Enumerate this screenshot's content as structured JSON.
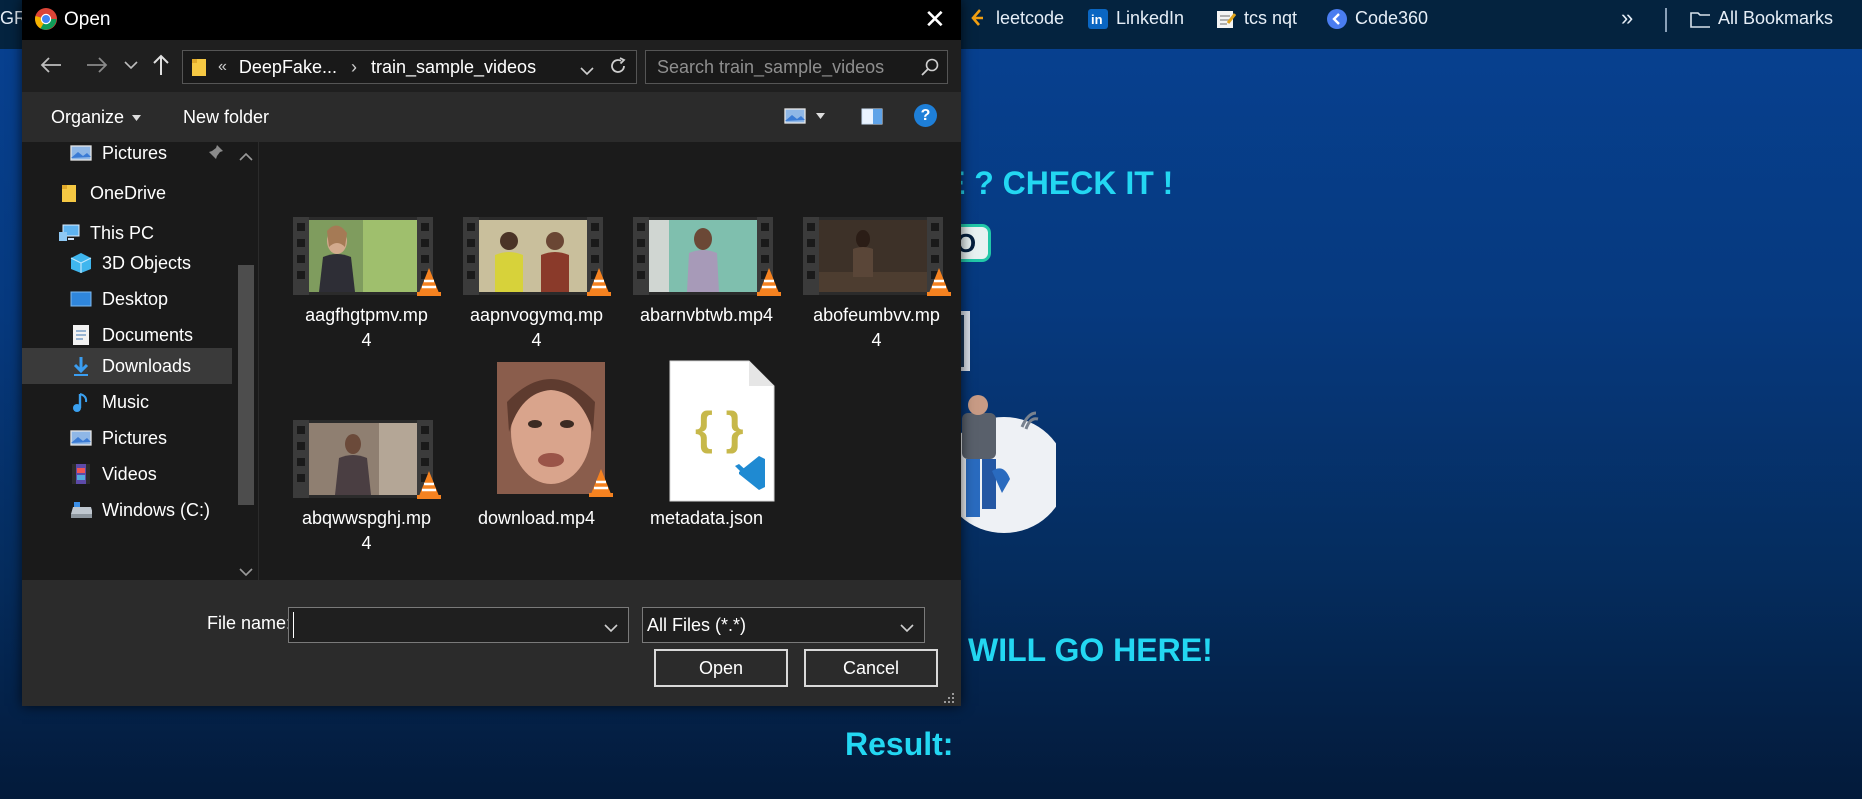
{
  "bookmarks": {
    "left_fragment": "GRE",
    "items": [
      {
        "label": "leetcode",
        "icon": "leetcode-icon"
      },
      {
        "label": "LinkedIn",
        "icon": "linkedin-icon"
      },
      {
        "label": "tcs nqt",
        "icon": "note-icon"
      },
      {
        "label": "Code360",
        "icon": "code360-icon"
      }
    ],
    "overflow": "»",
    "all_bookmarks": "All Bookmarks"
  },
  "webpage": {
    "heading_fragment": "E ? CHECK IT !",
    "button_fragment": "O",
    "placeholder_fragment": "WILL GO HERE!",
    "result_label": "Result:"
  },
  "dialog": {
    "title": "Open",
    "close": "✕",
    "address": {
      "chevrons": "«",
      "crumbs": [
        "DeepFake...",
        "train_sample_videos"
      ],
      "separator": "›",
      "search_placeholder": "Search train_sample_videos"
    },
    "toolbar": {
      "organize": "Organize",
      "new_folder": "New folder",
      "help": "?"
    },
    "nav": [
      {
        "label": "Pictures",
        "icon": "pictures-icon",
        "pinned": true
      },
      {
        "label": "OneDrive",
        "icon": "onedrive-folder-icon"
      },
      {
        "label": "This PC",
        "icon": "this-pc-icon"
      },
      {
        "label": "3D Objects",
        "icon": "3d-objects-icon"
      },
      {
        "label": "Desktop",
        "icon": "desktop-icon"
      },
      {
        "label": "Documents",
        "icon": "documents-icon"
      },
      {
        "label": "Downloads",
        "icon": "downloads-icon",
        "selected": true
      },
      {
        "label": "Music",
        "icon": "music-icon"
      },
      {
        "label": "Pictures",
        "icon": "pictures-icon"
      },
      {
        "label": "Videos",
        "icon": "videos-icon"
      },
      {
        "label": "Windows (C:)",
        "icon": "drive-icon"
      }
    ],
    "files": [
      {
        "name": "aagfhgtpmv.mp4",
        "line1": "aagfhgtpmv.mp",
        "line2": "4",
        "type": "video"
      },
      {
        "name": "aapnvogymq.mp4",
        "line1": "aapnvogymq.mp",
        "line2": "4",
        "type": "video"
      },
      {
        "name": "abarnvbtwb.mp4",
        "line1": "abarnvbtwb.mp4",
        "line2": "",
        "type": "video"
      },
      {
        "name": "abofeumbvv.mp4",
        "line1": "abofeumbvv.mp",
        "line2": "4",
        "type": "video"
      },
      {
        "name": "abqwwspghj.mp4",
        "line1": "abqwwspghj.mp",
        "line2": "4",
        "type": "video"
      },
      {
        "name": "download.mp4",
        "line1": "download.mp4",
        "line2": "",
        "type": "portrait-video"
      },
      {
        "name": "metadata.json",
        "line1": "metadata.json",
        "line2": "",
        "type": "json"
      }
    ],
    "bottom": {
      "file_name_label": "File name:",
      "file_name_value": "",
      "filter_value": "All Files (*.*)",
      "open_button": "Open",
      "cancel_button": "Cancel"
    }
  },
  "colors": {
    "accent_cyan": "#23d7f2",
    "nav_selected": "#3a3a3a",
    "vlc_orange": "#f58220",
    "json_braces": "#c7b84a",
    "vscode_blue": "#1f8ad2"
  }
}
